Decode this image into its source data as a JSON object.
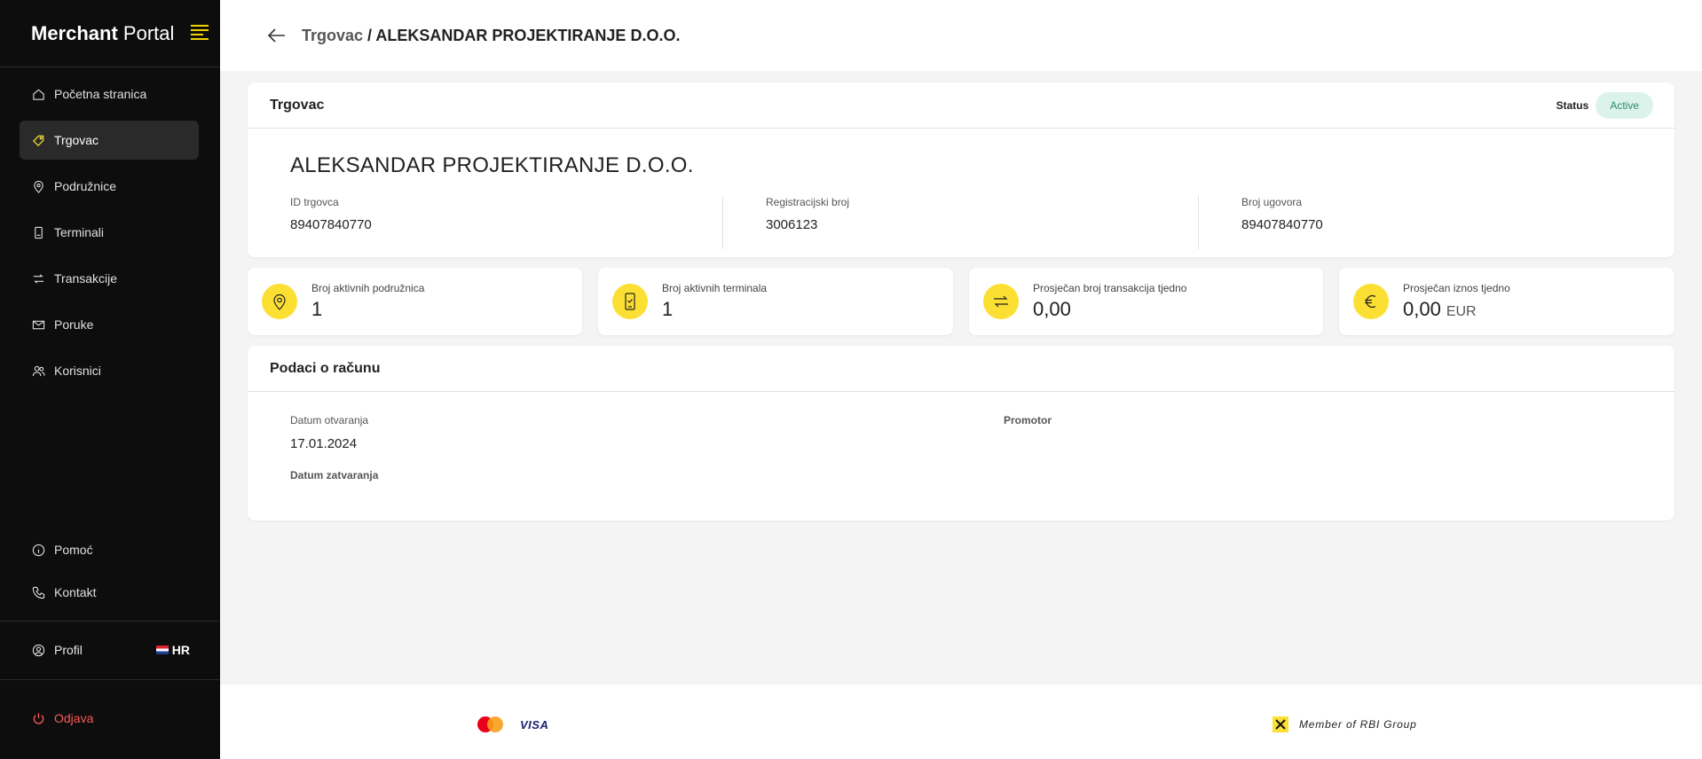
{
  "brand": {
    "bold": "Merchant",
    "light": "Portal"
  },
  "sidebar": {
    "items": [
      {
        "label": "Početna stranica",
        "icon": "home-icon"
      },
      {
        "label": "Trgovac",
        "icon": "tag-icon"
      },
      {
        "label": "Podružnice",
        "icon": "location-icon"
      },
      {
        "label": "Terminali",
        "icon": "terminal-icon"
      },
      {
        "label": "Transakcije",
        "icon": "transfer-icon"
      },
      {
        "label": "Poruke",
        "icon": "mail-icon"
      },
      {
        "label": "Korisnici",
        "icon": "users-icon"
      }
    ],
    "bottom": [
      {
        "label": "Pomoć",
        "icon": "info-icon"
      },
      {
        "label": "Kontakt",
        "icon": "phone-icon"
      }
    ],
    "profile": "Profil",
    "language": "HR",
    "logout": "Odjava"
  },
  "header": {
    "parent": "Trgovac",
    "separator": "/",
    "current": "ALEKSANDAR PROJEKTIRANJE D.O.O."
  },
  "merchant_card": {
    "title": "Trgovac",
    "status_label": "Status",
    "status_value": "Active",
    "name": "ALEKSANDAR PROJEKTIRANJE D.O.O.",
    "fields": [
      {
        "label": "ID trgovca",
        "value": "89407840770"
      },
      {
        "label": "Registracijski broj",
        "value": "3006123"
      },
      {
        "label": "Broj ugovora",
        "value": "89407840770"
      }
    ]
  },
  "stats": [
    {
      "label": "Broj aktivnih podružnica",
      "value": "1",
      "unit": "",
      "icon": "location-icon"
    },
    {
      "label": "Broj aktivnih terminala",
      "value": "1",
      "unit": "",
      "icon": "terminal-icon"
    },
    {
      "label": "Prosječan broj transakcija tjedno",
      "value": "0,00",
      "unit": "",
      "icon": "transfer-icon"
    },
    {
      "label": "Prosječan iznos tjedno",
      "value": "0,00",
      "unit": "EUR",
      "icon": "euro-icon"
    }
  ],
  "account": {
    "title": "Podaci o računu",
    "opening_label": "Datum otvaranja",
    "opening_value": "17.01.2024",
    "closing_label": "Datum zatvaranja",
    "promoter_label": "Promotor"
  },
  "footer": {
    "visa": "VISA",
    "rbi": "Member of RBI Group"
  },
  "colors": {
    "accent": "#fbe033",
    "sidebar_bg": "#0d0d0d",
    "status_bg": "#dcf3ec",
    "logout": "#ff5a5a"
  }
}
